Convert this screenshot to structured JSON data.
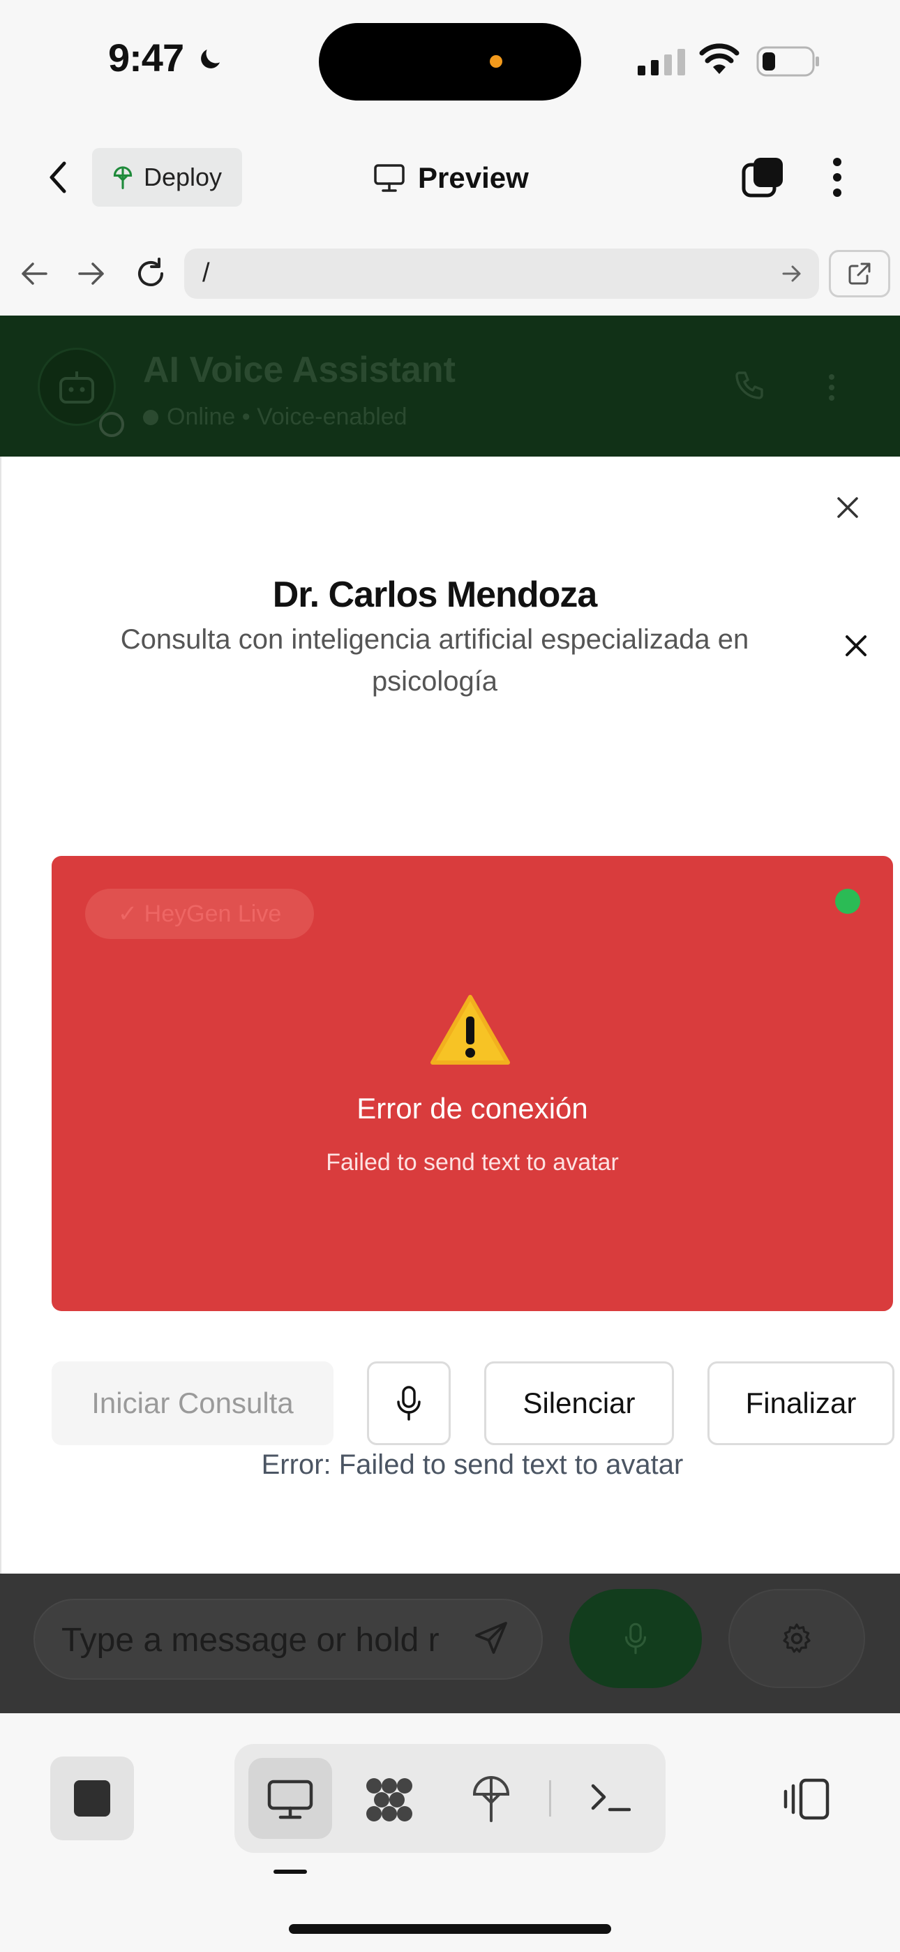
{
  "status_bar": {
    "time": "9:47"
  },
  "top_bar": {
    "deploy_label": "Deploy",
    "preview_label": "Preview"
  },
  "browser": {
    "url": "/"
  },
  "chat_header": {
    "title": "AI Voice Assistant",
    "subtitle": "Online • Voice-enabled"
  },
  "modal": {
    "title": "Dr. Carlos Mendoza",
    "subtitle": "Consulta con inteligencia artificial especializada en psicología",
    "badge": "✓ HeyGen Live",
    "error_title": "Error de conexión",
    "error_message": "Failed to send text to avatar",
    "buttons": {
      "start": "Iniciar Consulta",
      "mute": "Silenciar",
      "end": "Finalizar"
    },
    "footer_error": "Error: Failed to send text to avatar"
  },
  "chat_input": {
    "placeholder": "Type a message or hold r"
  },
  "colors": {
    "error_panel": "#d93c3d",
    "live_indicator": "#2bbb55",
    "header_bg": "#113117",
    "accent_green": "#123d1d"
  },
  "icons": [
    "back-chevron-icon",
    "deploy-icon",
    "monitor-icon",
    "tabs-icon",
    "more-vertical-icon",
    "arrow-left-icon",
    "arrow-right-icon",
    "reload-icon",
    "go-arrow-icon",
    "external-link-icon",
    "bot-icon",
    "phone-icon",
    "close-icon",
    "warning-icon",
    "mic-icon",
    "send-icon",
    "gear-icon",
    "stop-icon",
    "desktop-icon",
    "shapes-icon",
    "deploy-tree-icon",
    "terminal-icon",
    "split-panel-icon"
  ]
}
